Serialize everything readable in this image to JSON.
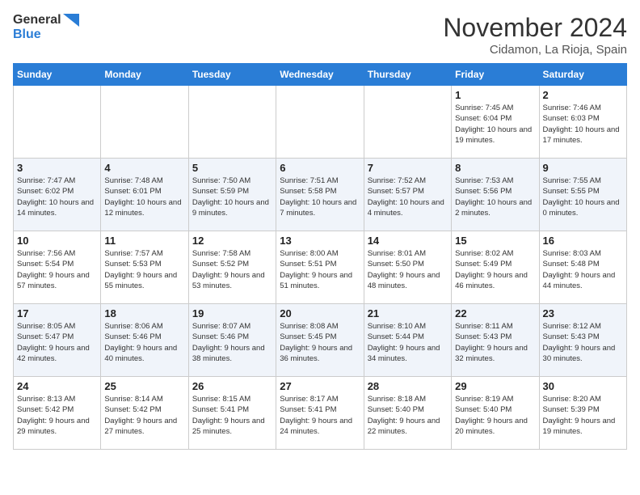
{
  "header": {
    "logo_line1": "General",
    "logo_line2": "Blue",
    "month": "November 2024",
    "location": "Cidamon, La Rioja, Spain"
  },
  "weekdays": [
    "Sunday",
    "Monday",
    "Tuesday",
    "Wednesday",
    "Thursday",
    "Friday",
    "Saturday"
  ],
  "weeks": [
    [
      {
        "day": "",
        "info": ""
      },
      {
        "day": "",
        "info": ""
      },
      {
        "day": "",
        "info": ""
      },
      {
        "day": "",
        "info": ""
      },
      {
        "day": "",
        "info": ""
      },
      {
        "day": "1",
        "info": "Sunrise: 7:45 AM\nSunset: 6:04 PM\nDaylight: 10 hours and 19 minutes."
      },
      {
        "day": "2",
        "info": "Sunrise: 7:46 AM\nSunset: 6:03 PM\nDaylight: 10 hours and 17 minutes."
      }
    ],
    [
      {
        "day": "3",
        "info": "Sunrise: 7:47 AM\nSunset: 6:02 PM\nDaylight: 10 hours and 14 minutes."
      },
      {
        "day": "4",
        "info": "Sunrise: 7:48 AM\nSunset: 6:01 PM\nDaylight: 10 hours and 12 minutes."
      },
      {
        "day": "5",
        "info": "Sunrise: 7:50 AM\nSunset: 5:59 PM\nDaylight: 10 hours and 9 minutes."
      },
      {
        "day": "6",
        "info": "Sunrise: 7:51 AM\nSunset: 5:58 PM\nDaylight: 10 hours and 7 minutes."
      },
      {
        "day": "7",
        "info": "Sunrise: 7:52 AM\nSunset: 5:57 PM\nDaylight: 10 hours and 4 minutes."
      },
      {
        "day": "8",
        "info": "Sunrise: 7:53 AM\nSunset: 5:56 PM\nDaylight: 10 hours and 2 minutes."
      },
      {
        "day": "9",
        "info": "Sunrise: 7:55 AM\nSunset: 5:55 PM\nDaylight: 10 hours and 0 minutes."
      }
    ],
    [
      {
        "day": "10",
        "info": "Sunrise: 7:56 AM\nSunset: 5:54 PM\nDaylight: 9 hours and 57 minutes."
      },
      {
        "day": "11",
        "info": "Sunrise: 7:57 AM\nSunset: 5:53 PM\nDaylight: 9 hours and 55 minutes."
      },
      {
        "day": "12",
        "info": "Sunrise: 7:58 AM\nSunset: 5:52 PM\nDaylight: 9 hours and 53 minutes."
      },
      {
        "day": "13",
        "info": "Sunrise: 8:00 AM\nSunset: 5:51 PM\nDaylight: 9 hours and 51 minutes."
      },
      {
        "day": "14",
        "info": "Sunrise: 8:01 AM\nSunset: 5:50 PM\nDaylight: 9 hours and 48 minutes."
      },
      {
        "day": "15",
        "info": "Sunrise: 8:02 AM\nSunset: 5:49 PM\nDaylight: 9 hours and 46 minutes."
      },
      {
        "day": "16",
        "info": "Sunrise: 8:03 AM\nSunset: 5:48 PM\nDaylight: 9 hours and 44 minutes."
      }
    ],
    [
      {
        "day": "17",
        "info": "Sunrise: 8:05 AM\nSunset: 5:47 PM\nDaylight: 9 hours and 42 minutes."
      },
      {
        "day": "18",
        "info": "Sunrise: 8:06 AM\nSunset: 5:46 PM\nDaylight: 9 hours and 40 minutes."
      },
      {
        "day": "19",
        "info": "Sunrise: 8:07 AM\nSunset: 5:46 PM\nDaylight: 9 hours and 38 minutes."
      },
      {
        "day": "20",
        "info": "Sunrise: 8:08 AM\nSunset: 5:45 PM\nDaylight: 9 hours and 36 minutes."
      },
      {
        "day": "21",
        "info": "Sunrise: 8:10 AM\nSunset: 5:44 PM\nDaylight: 9 hours and 34 minutes."
      },
      {
        "day": "22",
        "info": "Sunrise: 8:11 AM\nSunset: 5:43 PM\nDaylight: 9 hours and 32 minutes."
      },
      {
        "day": "23",
        "info": "Sunrise: 8:12 AM\nSunset: 5:43 PM\nDaylight: 9 hours and 30 minutes."
      }
    ],
    [
      {
        "day": "24",
        "info": "Sunrise: 8:13 AM\nSunset: 5:42 PM\nDaylight: 9 hours and 29 minutes."
      },
      {
        "day": "25",
        "info": "Sunrise: 8:14 AM\nSunset: 5:42 PM\nDaylight: 9 hours and 27 minutes."
      },
      {
        "day": "26",
        "info": "Sunrise: 8:15 AM\nSunset: 5:41 PM\nDaylight: 9 hours and 25 minutes."
      },
      {
        "day": "27",
        "info": "Sunrise: 8:17 AM\nSunset: 5:41 PM\nDaylight: 9 hours and 24 minutes."
      },
      {
        "day": "28",
        "info": "Sunrise: 8:18 AM\nSunset: 5:40 PM\nDaylight: 9 hours and 22 minutes."
      },
      {
        "day": "29",
        "info": "Sunrise: 8:19 AM\nSunset: 5:40 PM\nDaylight: 9 hours and 20 minutes."
      },
      {
        "day": "30",
        "info": "Sunrise: 8:20 AM\nSunset: 5:39 PM\nDaylight: 9 hours and 19 minutes."
      }
    ]
  ]
}
